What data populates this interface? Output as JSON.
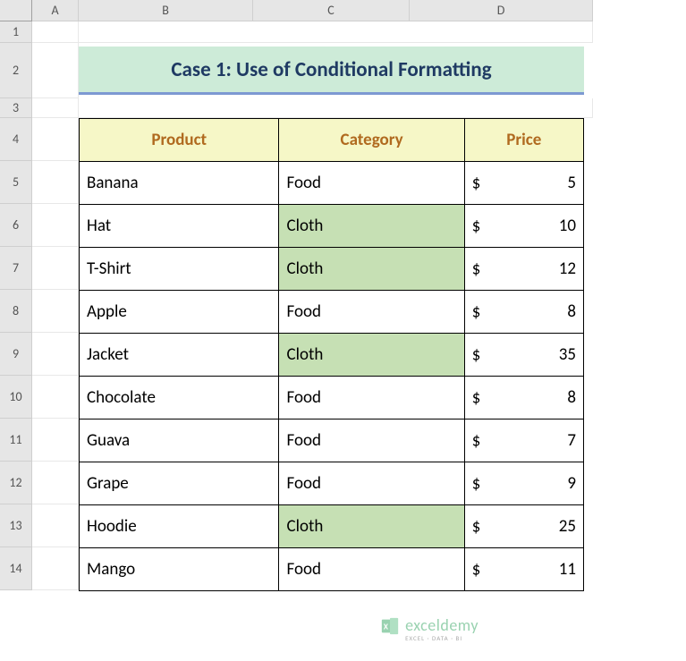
{
  "columns": [
    "",
    "A",
    "B",
    "C",
    "D"
  ],
  "row_headers": [
    "1",
    "2",
    "3",
    "4",
    "5",
    "6",
    "7",
    "8",
    "9",
    "10",
    "11",
    "12",
    "13",
    "14"
  ],
  "title": "Case 1: Use of Conditional Formatting",
  "headers": {
    "product": "Product",
    "category": "Category",
    "price": "Price"
  },
  "currency_symbol": "$",
  "highlight_category": "Cloth",
  "rows": [
    {
      "product": "Banana",
      "category": "Food",
      "price": 5,
      "highlighted": false
    },
    {
      "product": "Hat",
      "category": "Cloth",
      "price": 10,
      "highlighted": true
    },
    {
      "product": "T-Shirt",
      "category": "Cloth",
      "price": 12,
      "highlighted": true
    },
    {
      "product": "Apple",
      "category": "Food",
      "price": 8,
      "highlighted": false
    },
    {
      "product": "Jacket",
      "category": "Cloth",
      "price": 35,
      "highlighted": true
    },
    {
      "product": "Chocolate",
      "category": "Food",
      "price": 8,
      "highlighted": false
    },
    {
      "product": "Guava",
      "category": "Food",
      "price": 7,
      "highlighted": false
    },
    {
      "product": "Grape",
      "category": "Food",
      "price": 9,
      "highlighted": false
    },
    {
      "product": "Hoodie",
      "category": "Cloth",
      "price": 25,
      "highlighted": true
    },
    {
      "product": "Mango",
      "category": "Food",
      "price": 11,
      "highlighted": false
    }
  ],
  "watermark": {
    "brand": "exceldemy",
    "tagline": "EXCEL · DATA · BI"
  },
  "colors": {
    "title_bg": "#cdebd8",
    "title_fg": "#1f3a63",
    "title_underline": "#7d99d2",
    "header_bg": "#f6f7c7",
    "header_fg": "#b06a1f",
    "highlight_bg": "#c6e0b4"
  },
  "chart_data": {
    "type": "table",
    "title": "Case 1: Use of Conditional Formatting",
    "columns": [
      "Product",
      "Category",
      "Price"
    ],
    "rows": [
      [
        "Banana",
        "Food",
        5
      ],
      [
        "Hat",
        "Cloth",
        10
      ],
      [
        "T-Shirt",
        "Cloth",
        12
      ],
      [
        "Apple",
        "Food",
        8
      ],
      [
        "Jacket",
        "Cloth",
        35
      ],
      [
        "Chocolate",
        "Food",
        8
      ],
      [
        "Guava",
        "Food",
        7
      ],
      [
        "Grape",
        "Food",
        9
      ],
      [
        "Hoodie",
        "Cloth",
        25
      ],
      [
        "Mango",
        "Food",
        11
      ]
    ]
  }
}
